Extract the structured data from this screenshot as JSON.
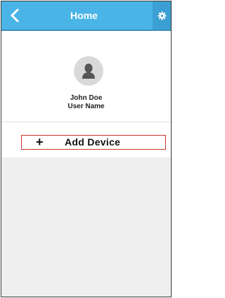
{
  "header": {
    "title": "Home",
    "back_icon": "chevron-left-icon",
    "settings_icon": "gear-icon",
    "bg_color": "#4ab4e6"
  },
  "profile": {
    "avatar_icon": "user-icon",
    "name": "John Doe",
    "username": "User Name"
  },
  "actions": {
    "add_device_icon": "plus-icon",
    "add_device_label": "Add Device",
    "border_color": "#c8342f"
  },
  "device_list": {
    "items": []
  }
}
